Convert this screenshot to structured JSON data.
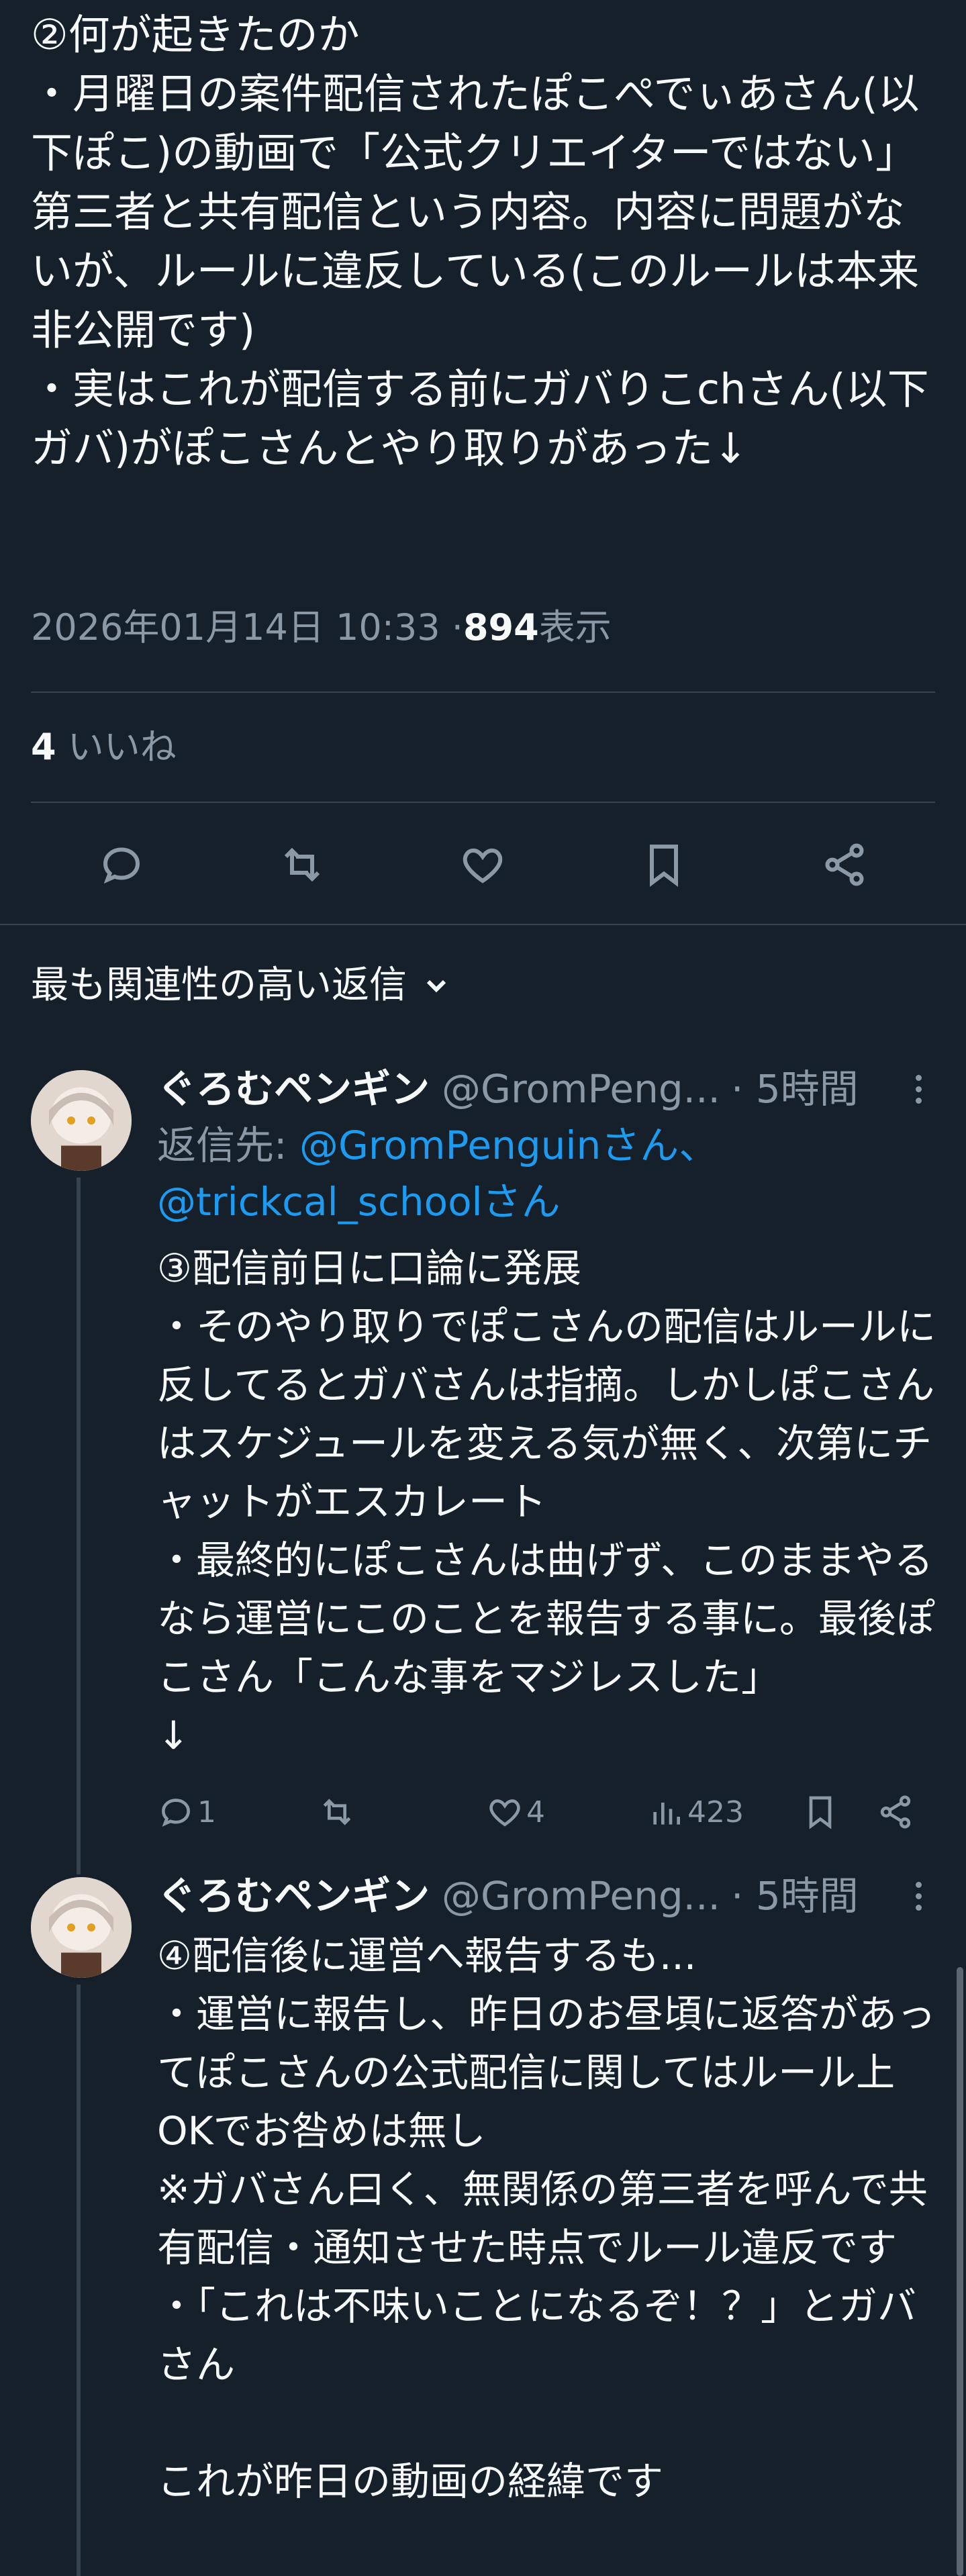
{
  "tweet": {
    "body": "②何が起きたのか\n・月曜日の案件配信されたぽこぺでぃあさん(以下ぽこ)の動画で「公式クリエイターではない」第三者と共有配信という内容。内容に問題がないが、ルールに違反している(このルールは本来非公開です)\n・実はこれが配信する前にガバりこchさん(以下ガバ)がぽこさんとやり取りがあった↓",
    "date": "2026年01月14日 10:33 · ",
    "views": "894",
    "views_label": " 表示",
    "likes": "4",
    "likes_label": " いいね"
  },
  "actions": {
    "icons": [
      "reply-icon",
      "retweet-icon",
      "like-icon",
      "bookmark-icon",
      "share-icon"
    ]
  },
  "sort": {
    "label": "最も関連性の高い返信"
  },
  "replies": [
    {
      "name": "ぐろむペンギン",
      "handle": "@GromPeng...",
      "time": "· 5時間",
      "reply_to_label": "返信先: ",
      "reply_to_1": "@GromPenguinさん、",
      "reply_to_2": "@trickcal_schoolさん",
      "body": "③配信前日に口論に発展\n・そのやり取りでぽこさんの配信はルールに反してるとガバさんは指摘。しかしぽこさんはスケジュールを変える気が無く、次第にチャットがエスカレート\n・最終的にぽこさんは曲げず、このままやるなら運営にこのことを報告する事に。最後ぽこさん「こんな事をマジレスした」\n↓",
      "replies": "1",
      "likes": "4",
      "views": "423"
    },
    {
      "name": "ぐろむペンギン",
      "handle": "@GromPeng...",
      "time": "· 5時間",
      "body": "④配信後に運営へ報告するも...\n・運営に報告し、昨日のお昼頃に返答があってぽこさんの公式配信に関してはルール上OKでお咎めは無し\n※ガバさん曰く、無関係の第三者を呼んで共有配信・通知させた時点でルール違反です\n・「これは不味いことになるぞ！？」とガバさん\n\nこれが昨日の動画の経緯です"
    }
  ],
  "colors": {
    "background": "#15202b",
    "text": "#f7f9f9",
    "muted": "#8b98a5",
    "link": "#1d9bf0",
    "divider": "#38444d"
  }
}
